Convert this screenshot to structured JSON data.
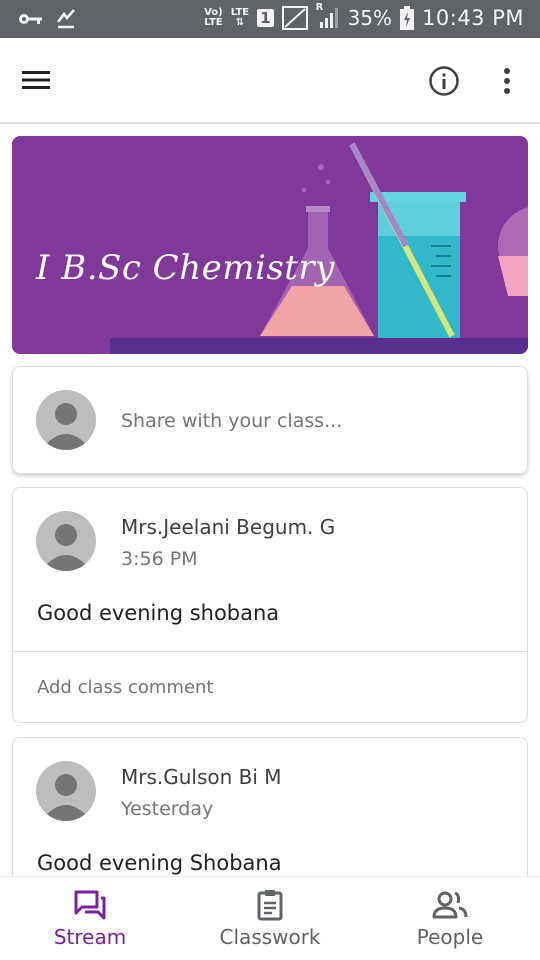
{
  "status_bar": {
    "net_top": "Vo)",
    "net_bottom": "LTE",
    "lte_label": "LTE",
    "sim_slot": "1",
    "roaming": "R",
    "battery_percent": "35%",
    "time": "10:43 PM"
  },
  "class": {
    "title": "I B.Sc Chemistry",
    "banner_color": "#813999"
  },
  "share": {
    "placeholder": "Share with your class..."
  },
  "posts": [
    {
      "author": "Mrs.Jeelani Begum. G",
      "time": "3:56 PM",
      "text": "Good evening shobana",
      "comment_placeholder": "Add class comment"
    },
    {
      "author": "Mrs.Gulson Bi M",
      "time": "Yesterday",
      "text": "Good evening Shobana"
    }
  ],
  "bottom_nav": {
    "items": [
      {
        "label": "Stream",
        "icon": "stream-icon",
        "active": true
      },
      {
        "label": "Classwork",
        "icon": "classwork-icon",
        "active": false
      },
      {
        "label": "People",
        "icon": "people-icon",
        "active": false
      }
    ],
    "active_color": "#7b1fa2"
  }
}
